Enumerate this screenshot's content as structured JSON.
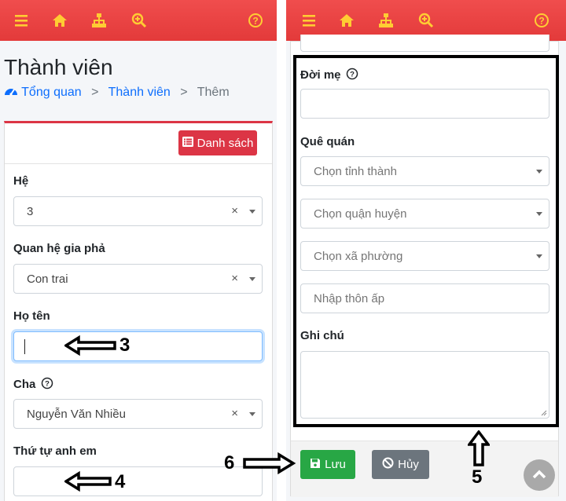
{
  "left": {
    "page_title": "Thành viên",
    "breadcrumb": {
      "home": "Tổng quan",
      "section": "Thành viên",
      "current": "Thêm",
      "separator": ">"
    },
    "list_button": "Danh sách",
    "fields": {
      "he": {
        "label": "Hệ",
        "value": "3"
      },
      "quan_he": {
        "label": "Quan hệ gia phả",
        "value": "Con trai"
      },
      "ho_ten": {
        "label": "Họ tên",
        "value": ""
      },
      "cha": {
        "label": "Cha",
        "value": "Nguyễn Văn Nhiều"
      },
      "thu_tu": {
        "label": "Thứ tự anh em",
        "value": ""
      }
    }
  },
  "right": {
    "fields": {
      "doi_me": {
        "label": "Đời mẹ",
        "value": ""
      },
      "que_quan": {
        "label": "Quê quán"
      },
      "tinh": {
        "placeholder": "Chọn tỉnh thành"
      },
      "huyen": {
        "placeholder": "Chọn quận huyện"
      },
      "xa": {
        "placeholder": "Chọn xã phường"
      },
      "thon": {
        "placeholder": "Nhập thôn ấp"
      },
      "ghi_chu": {
        "label": "Ghi chú",
        "value": ""
      }
    },
    "save_button": "Lưu",
    "cancel_button": "Hủy"
  },
  "annotations": {
    "n3": "3",
    "n4": "4",
    "n5": "5",
    "n6": "6"
  },
  "icons": [
    "menu-icon",
    "home-icon",
    "sitemap-icon",
    "zoom-icon",
    "help-icon"
  ],
  "colors": {
    "topbar": "#e53e3e",
    "icon": "#ffcc33",
    "primary": "#dc3545",
    "success": "#28a745",
    "secondary": "#6c757d",
    "link": "#0d6efd",
    "focus": "#80bdff"
  }
}
